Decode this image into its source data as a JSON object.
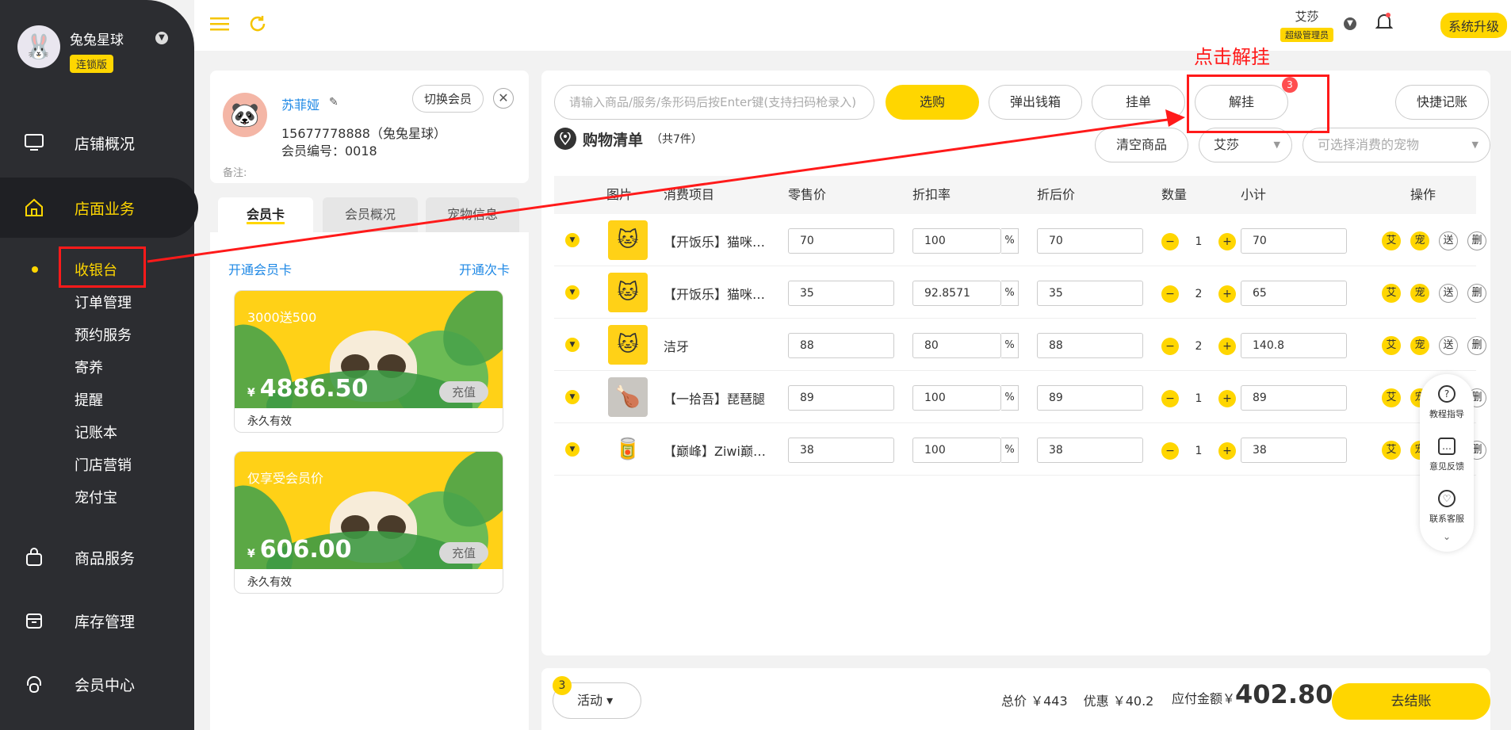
{
  "brand": {
    "name": "兔兔星球",
    "edition": "连锁版"
  },
  "nav": [
    {
      "label": "店铺概况"
    },
    {
      "label": "店面业务"
    },
    {
      "label": "商品服务"
    },
    {
      "label": "库存管理"
    },
    {
      "label": "会员中心"
    }
  ],
  "subnav": [
    "收银台",
    "订单管理",
    "预约服务",
    "寄养",
    "提醒",
    "记账本",
    "门店营销",
    "宠付宝"
  ],
  "topbar": {
    "user_name": "艾莎",
    "user_role": "超级管理员",
    "upgrade": "系统升级"
  },
  "member": {
    "name": "苏菲娅",
    "phone": "15677778888（兔兔星球）",
    "number": "会员编号：0018",
    "note": "备注:",
    "switch": "切换会员",
    "close": "✕"
  },
  "member_tabs": [
    "会员卡",
    "会员概况",
    "宠物信息"
  ],
  "cards_panel": {
    "open_card": "开通会员卡",
    "open_times": "开通次卡",
    "cards": [
      {
        "title": "3000送500",
        "currency": "¥",
        "amount": "4886.50",
        "action": "充值",
        "validity": "永久有效"
      },
      {
        "title": "仅享受会员价",
        "currency": "¥",
        "amount": "606.00",
        "action": "充值",
        "validity": "永久有效"
      }
    ]
  },
  "toolbar": {
    "search_placeholder": "请输入商品/服务/条形码后按Enter键(支持扫码枪录入)",
    "select": "选购",
    "cash_drawer": "弹出钱箱",
    "hang": "挂单",
    "unhang": "解挂",
    "unhang_badge": "3",
    "quick_account": "快捷记账"
  },
  "cart": {
    "title": "购物清单",
    "count": "（共7件）",
    "clear": "清空商品",
    "staff": "艾莎",
    "pet_placeholder": "可选择消费的宠物"
  },
  "table": {
    "headers": [
      "图片",
      "消费项目",
      "零售价",
      "折扣率",
      "折后价",
      "数量",
      "小计",
      "操作"
    ],
    "pct_symbol": "%",
    "ops": [
      "艾",
      "宠",
      "送",
      "删"
    ],
    "rows": [
      {
        "name": "【开饭乐】猫咪罐头",
        "price": "70",
        "discount": "100",
        "after": "70",
        "qty": "1",
        "subtotal": "70",
        "thumb": "cat-face-icon"
      },
      {
        "name": "【开饭乐】猫咪罐头",
        "price": "35",
        "discount": "92.8571",
        "after": "35",
        "qty": "2",
        "subtotal": "65",
        "thumb": "cat-face-icon"
      },
      {
        "name": "洁牙",
        "price": "88",
        "discount": "80",
        "after": "88",
        "qty": "2",
        "subtotal": "140.8",
        "thumb": "cat-face-icon"
      },
      {
        "name": "【一拾吾】琵琶腿",
        "price": "89",
        "discount": "100",
        "after": "89",
        "qty": "1",
        "subtotal": "89",
        "thumb": "product-photo-icon"
      },
      {
        "name": "【巅峰】Ziwi巅峰罐头",
        "price": "38",
        "discount": "100",
        "after": "38",
        "qty": "1",
        "subtotal": "38",
        "thumb": "can-icon"
      }
    ]
  },
  "help": [
    {
      "label": "教程指导",
      "icon": "?"
    },
    {
      "label": "意见反馈",
      "icon": "…"
    },
    {
      "label": "联系客服",
      "icon": "♡"
    }
  ],
  "bottom": {
    "activity": "活动",
    "activity_badge": "3",
    "total": "总价 ￥443",
    "discount": "优惠 ￥40.2",
    "payable_label": "应付金额￥",
    "payable": "402.80",
    "checkout": "去结账"
  },
  "annotation": {
    "text": "点击解挂"
  },
  "colors": {
    "accent": "#ffd600",
    "sidebar": "#2c2d31",
    "link": "#1e88e5",
    "annotation": "#ff1a1a"
  }
}
